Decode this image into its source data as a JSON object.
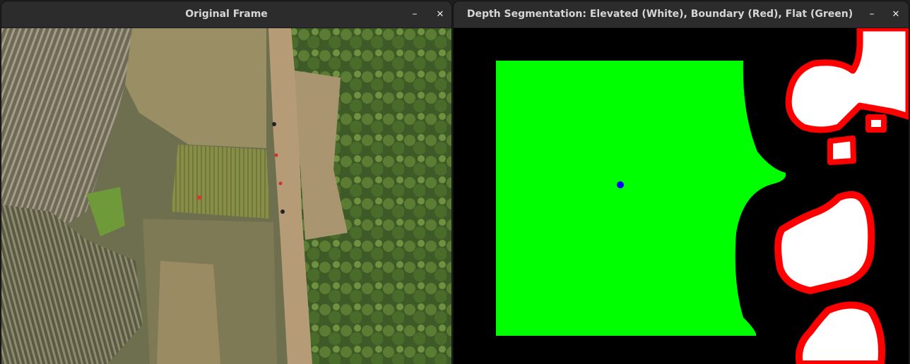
{
  "windows": [
    {
      "title": "Original Frame",
      "content": "aerial-drone-photo"
    },
    {
      "title": "Depth Segmentation: Elevated (White), Boundary (Red), Flat (Green)",
      "content": "segmentation-mask"
    }
  ],
  "controls": {
    "minimize": "–",
    "close": "✕"
  },
  "segmentation_colors": {
    "background": "#000000",
    "flat": "#00ff00",
    "boundary": "#ff0000",
    "elevated": "#ffffff",
    "center_marker": "#0000ff"
  }
}
